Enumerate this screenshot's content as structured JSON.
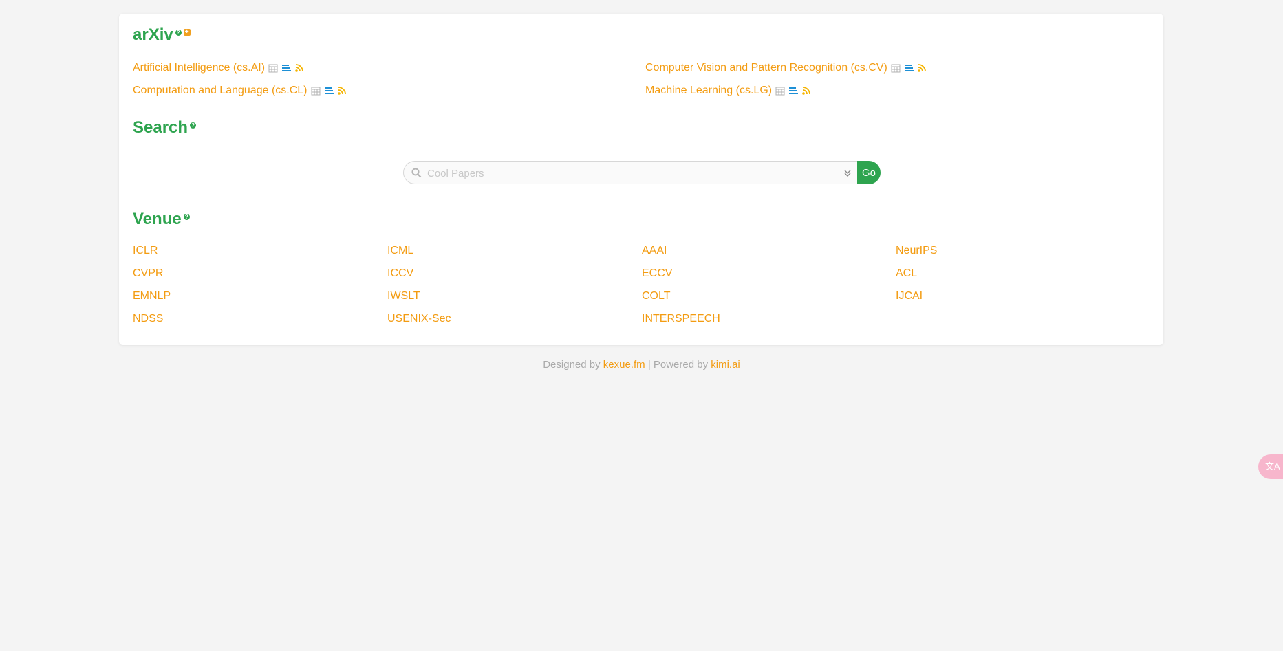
{
  "arxiv": {
    "title": "arXiv",
    "items": [
      {
        "label": "Artificial Intelligence (cs.AI)"
      },
      {
        "label": "Computer Vision and Pattern Recognition (cs.CV)"
      },
      {
        "label": "Computation and Language (cs.CL)"
      },
      {
        "label": "Machine Learning (cs.LG)"
      }
    ]
  },
  "search": {
    "title": "Search",
    "placeholder": "Cool Papers",
    "go_label": "Go"
  },
  "venue": {
    "title": "Venue",
    "items": [
      "ICLR",
      "ICML",
      "AAAI",
      "NeurIPS",
      "CVPR",
      "ICCV",
      "ECCV",
      "ACL",
      "EMNLP",
      "IWSLT",
      "COLT",
      "IJCAI",
      "NDSS",
      "USENIX-Sec",
      "INTERSPEECH"
    ]
  },
  "footer": {
    "designed_prefix": "Designed by",
    "designed_link": "kexue.fm",
    "separator": "| Powered by",
    "powered_link": "kimi.ai"
  },
  "colors": {
    "accent_green": "#2ea44f",
    "link_orange": "#f39c12",
    "list_icon_blue": "#1e90d6",
    "rss_yellow": "#f5b400"
  },
  "icons": [
    "help-icon",
    "plus-icon",
    "calendar-icon",
    "list-icon",
    "rss-icon",
    "search-icon",
    "chevron-down-icon",
    "translate-icon"
  ]
}
